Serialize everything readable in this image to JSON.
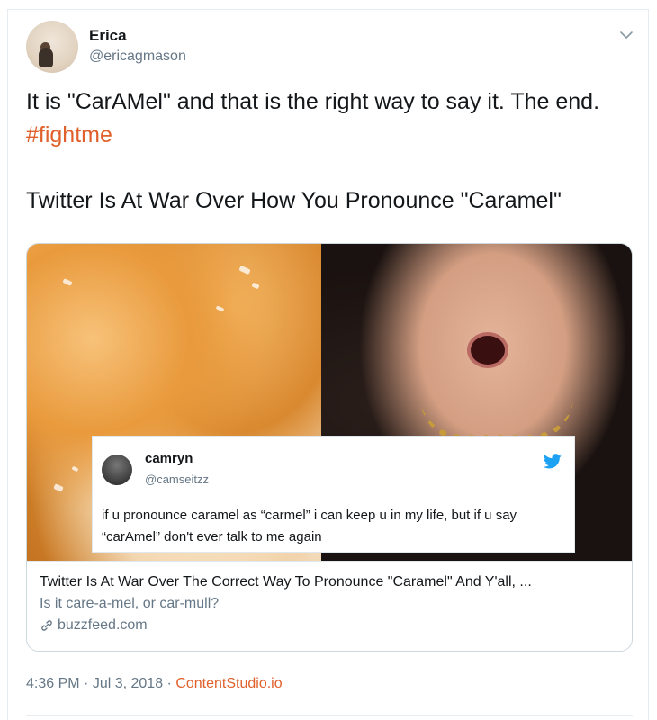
{
  "user": {
    "display_name": "Erica",
    "handle": "@ericagmason"
  },
  "tweet": {
    "text_part1": "It is \"CarAMel\" and that is the right way to say it. The end. ",
    "hashtag": "#fightme",
    "text_part2": "Twitter Is At War Over How You Pronounce \"Caramel\""
  },
  "card": {
    "embedded_tweet": {
      "display_name": "camryn",
      "handle": "@camseitzz",
      "text": "if u pronounce caramel as “carmel” i can keep u in my life, but if u say “carAmel” don't ever talk to me again"
    },
    "title": "Twitter Is At War Over The Correct Way To Pronounce \"Caramel\" And Y'all, ...",
    "description": "Is it care-a-mel, or car-mull?",
    "domain": "buzzfeed.com"
  },
  "meta": {
    "time": "4:36 PM",
    "separator1": " · ",
    "date": "Jul 3, 2018",
    "separator2": " · ",
    "source": "ContentStudio.io"
  },
  "colors": {
    "accent": "#e0602b",
    "secondary_text": "#657786",
    "border": "#ccd6dd",
    "twitter_blue": "#1da1f2"
  },
  "icons": {
    "menu": "chevron-down-icon",
    "embedded_logo": "twitter-bird-icon",
    "domain": "link-icon"
  }
}
